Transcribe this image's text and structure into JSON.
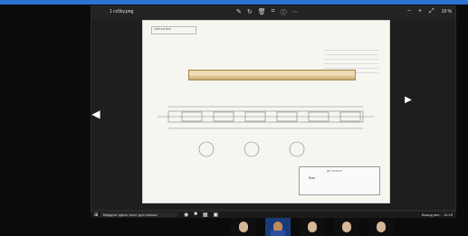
{
  "topbar": {
    "label": ""
  },
  "viewer": {
    "file_name": "1 cc6ky.png",
    "toolbar_icons": [
      "annotate-icon",
      "rotate-icon",
      "delete-icon",
      "crop-icon",
      "info-icon",
      "more-icon"
    ],
    "right_icons": [
      "zoom-out-icon",
      "zoom-in-icon",
      "fit-icon"
    ],
    "zoom_label": "19 %"
  },
  "sheet": {
    "stamp_top": "ЧЕРТЕЖ ВАЛ",
    "part_name": "Вал",
    "title_code": "ДП 15.05.03"
  },
  "taskbar": {
    "search_placeholder": "Введите здесь текст для поиска",
    "tray_text": "Выход вне... 14:15"
  },
  "colors": {
    "background": "#0b0b0c",
    "viewer": "#1e1e1e",
    "sheet": "#f6f6f1",
    "accent": "#2b73d1",
    "shaft": "#e7d4a4"
  }
}
